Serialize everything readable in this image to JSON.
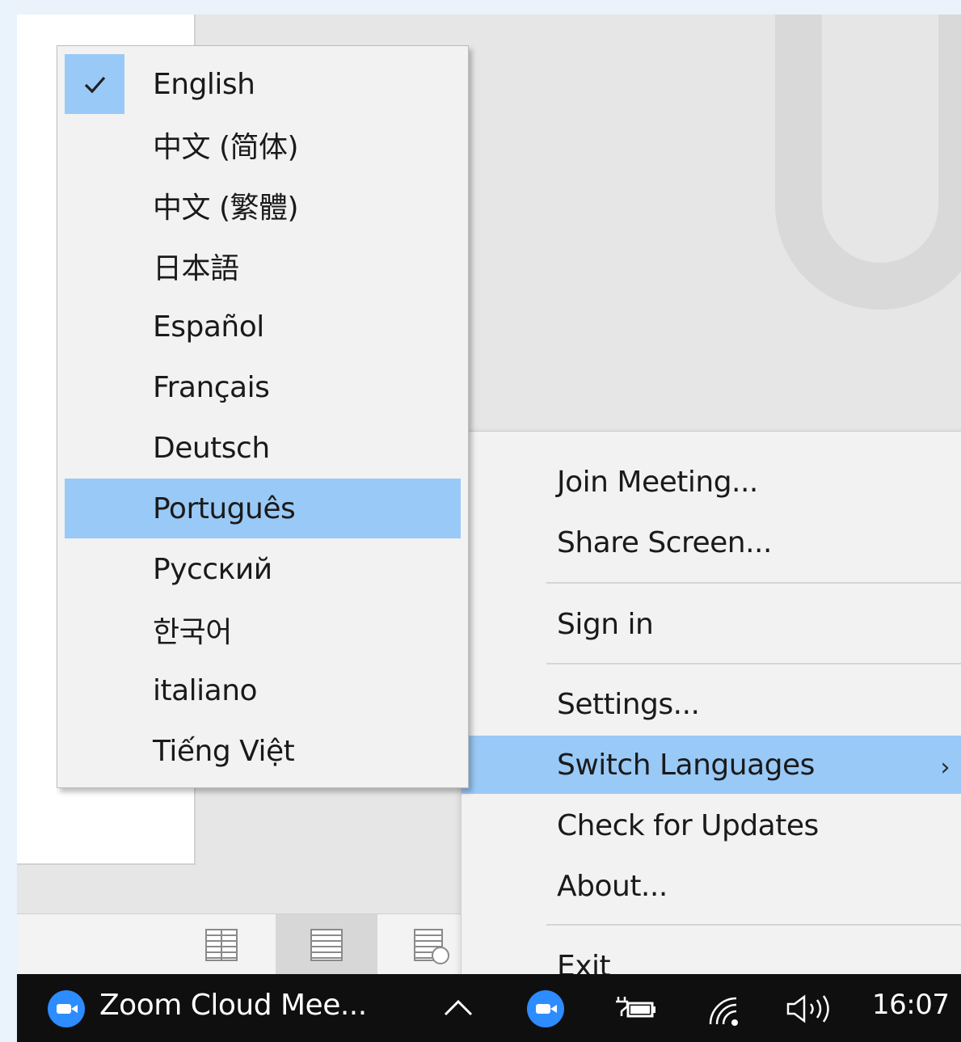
{
  "tray_menu": {
    "items": [
      {
        "label": "Join Meeting..."
      },
      {
        "label": "Share Screen..."
      },
      {
        "label": "Sign in"
      },
      {
        "label": "Settings..."
      },
      {
        "label": "Switch Languages",
        "highlighted": true,
        "has_submenu": true
      },
      {
        "label": "Check for Updates"
      },
      {
        "label": "About..."
      },
      {
        "label": "Exit"
      }
    ],
    "submenu_chevron": "›"
  },
  "language_menu": {
    "selected": "English",
    "hovered": "Português",
    "items": [
      {
        "label": "English",
        "checked": true
      },
      {
        "label": "中文 (简体)"
      },
      {
        "label": "中文 (繁體)"
      },
      {
        "label": "日本語"
      },
      {
        "label": "Español"
      },
      {
        "label": "Français"
      },
      {
        "label": "Deutsch"
      },
      {
        "label": "Português",
        "highlighted": true
      },
      {
        "label": "Русский"
      },
      {
        "label": "한국어"
      },
      {
        "label": "italiano"
      },
      {
        "label": "Tiếng Việt"
      }
    ]
  },
  "taskbar": {
    "app_label": "Zoom Cloud Mee...",
    "clock": "16:07",
    "icons": [
      "zoom-app-icon",
      "show-hidden-icons-chevron-icon",
      "zoom-tray-icon",
      "battery-plugged-icon",
      "wifi-icon",
      "volume-icon"
    ]
  },
  "view_bar": {
    "icons": [
      "reading-view-icon",
      "print-layout-icon",
      "web-layout-icon"
    ],
    "active": "print-layout-icon"
  },
  "colors": {
    "highlight": "#99c9f6",
    "menu_bg": "#f2f2f2",
    "taskbar_bg": "#0f0f0f",
    "zoom_blue": "#2d8cff",
    "page_border": "#eaf2fb"
  }
}
